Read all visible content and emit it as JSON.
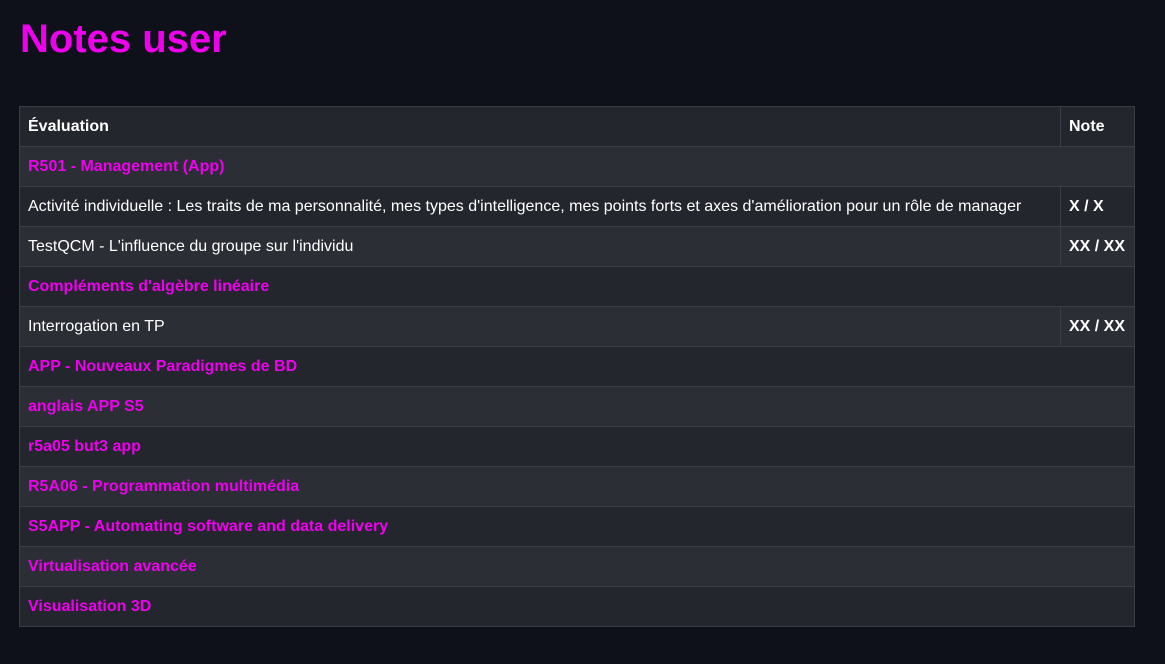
{
  "page": {
    "title": "Notes user"
  },
  "table": {
    "headers": {
      "evaluation": "Évaluation",
      "note": "Note"
    },
    "rows": [
      {
        "type": "group",
        "label": "R501 - Management (App)"
      },
      {
        "type": "eval",
        "label": "Activité individuelle : Les traits de ma personnalité, mes types d'intelligence, mes points forts et axes d'amélioration pour un rôle de manager",
        "note": "X / X"
      },
      {
        "type": "eval",
        "label": "TestQCM - L'influence du groupe sur l'individu",
        "note": "XX / XX"
      },
      {
        "type": "group",
        "label": "Compléments d'algèbre linéaire"
      },
      {
        "type": "eval",
        "label": "Interrogation en TP",
        "note": "XX / XX"
      },
      {
        "type": "group",
        "label": "APP - Nouveaux Paradigmes de BD"
      },
      {
        "type": "group",
        "label": "anglais APP S5"
      },
      {
        "type": "group",
        "label": "r5a05 but3 app"
      },
      {
        "type": "group",
        "label": "R5A06 - Programmation multimédia"
      },
      {
        "type": "group",
        "label": "S5APP - Automating software and data delivery"
      },
      {
        "type": "group",
        "label": "Virtualisation avancée"
      },
      {
        "type": "group",
        "label": "Visualisation 3D"
      }
    ]
  },
  "colors": {
    "background": "#0f111a",
    "accent": "#ee00ee",
    "row_dark": "#23262c",
    "row_light": "#2b2e34",
    "border": "#3a3d45",
    "text": "#ffffff"
  }
}
